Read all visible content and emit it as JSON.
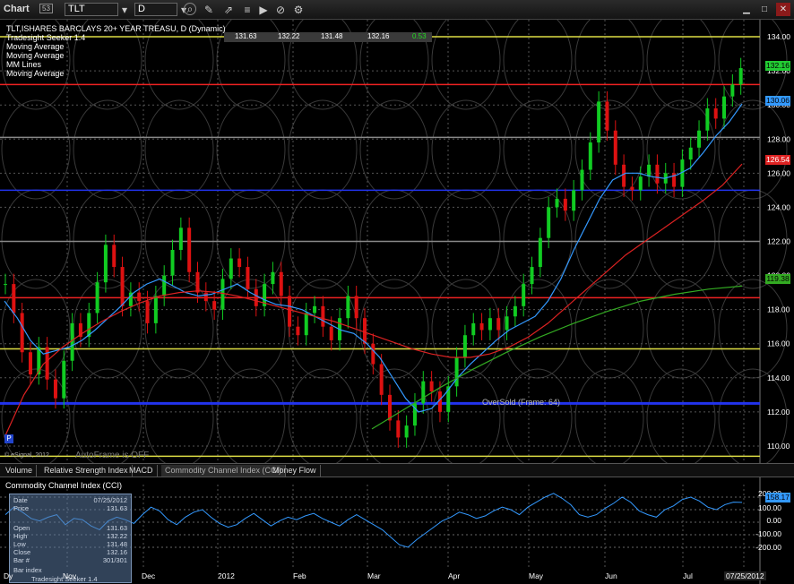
{
  "toolbar": {
    "app_label": "Chart",
    "symbol": "TLT",
    "interval": "D"
  },
  "header": {
    "title": "TLT,ISHARES BARCLAYS 20+ YEAR TREASU, D (Dynamic)",
    "legend": [
      "Tradesight Seeker 1.4",
      "Moving Average",
      "Moving Average",
      "MM Lines",
      "Moving Average"
    ],
    "ohlc": [
      "131.63",
      "132.22",
      "131.48",
      "132.16"
    ],
    "change": "0.53"
  },
  "colors": {
    "up": "#11cc22",
    "down": "#dd1111",
    "ma_fast": "#3399ff",
    "ma_mid": "#dd2222",
    "ma_slow": "#33aa22",
    "line_red": "#ee2222",
    "line_blue": "#2233ee",
    "line_yellow": "#dddd44"
  },
  "annotations": {
    "autoframe": "AutoFrame is OFF",
    "copyright": "© eSignal, 2012",
    "oversold": "OverSold (Frame: 64)",
    "p_marker": "P"
  },
  "price_tags": {
    "last": "132.16",
    "ma_fast": "130.06",
    "ma_mid": "126.54",
    "ma_slow": "119.38"
  },
  "tabs": [
    "Volume",
    "Relative Strength Index",
    "MACD",
    "Commodity Channel Index (CCI)",
    "Money Flow"
  ],
  "active_tab": 3,
  "cci_panel": {
    "title": "Commodity Channel Index (CCI)",
    "axis": [
      "200.00",
      "100.00",
      "0.00",
      "-100.00",
      "-200.00"
    ],
    "last_value": "158.17"
  },
  "data_window": {
    "rows": [
      "Date",
      "Price",
      "Open",
      "High",
      "Low",
      "Close",
      "Bar #",
      "Bar index"
    ],
    "values": [
      "07/25/2012",
      "131.63",
      "131.63",
      "132.22",
      "131.48",
      "132.16",
      "301/301",
      ""
    ],
    "footer": "Tradesight Seeker 1.4"
  },
  "x_axis": {
    "months": [
      "Nov",
      "Dec",
      "2012",
      "Feb",
      "Mar",
      "Apr",
      "May",
      "Jun",
      "Jul"
    ],
    "last_date": "07/25/2012"
  },
  "chart_data": {
    "type": "candlestick",
    "title": "TLT,ISHARES BARCLAYS 20+ YEAR TREASU, D (Dynamic)",
    "ylim": [
      109,
      135
    ],
    "y_ticks": [
      110,
      112,
      114,
      116,
      118,
      120,
      122,
      124,
      126,
      128,
      130,
      132,
      134
    ],
    "horizontal_levels": [
      {
        "value": 134.0,
        "color": "#dddd44"
      },
      {
        "value": 131.2,
        "color": "#ee2222"
      },
      {
        "value": 128.1,
        "color": "#888888"
      },
      {
        "value": 125.0,
        "color": "#2233ee"
      },
      {
        "value": 122.0,
        "color": "#888888"
      },
      {
        "value": 118.7,
        "color": "#ee2222"
      },
      {
        "value": 115.7,
        "color": "#dddd44"
      },
      {
        "value": 112.5,
        "color": "#2233ee"
      },
      {
        "value": 109.4,
        "color": "#dddd44"
      }
    ],
    "close_path": [
      119.5,
      117.8,
      115.5,
      114.2,
      115.8,
      113.9,
      112.8,
      115.0,
      117.2,
      116.4,
      117.8,
      119.6,
      121.8,
      120.5,
      118.2,
      119.0,
      118.5,
      117.2,
      118.8,
      120.0,
      121.5,
      122.8,
      120.2,
      119.0,
      118.5,
      118.0,
      119.8,
      121.0,
      120.5,
      119.2,
      118.2,
      119.5,
      120.2,
      118.8,
      117.0,
      116.5,
      117.8,
      118.2,
      117.0,
      116.2,
      117.5,
      118.8,
      117.5,
      116.0,
      114.8,
      113.0,
      111.5,
      110.5,
      111.2,
      112.5,
      113.8,
      113.2,
      112.0,
      113.5,
      115.2,
      116.5,
      117.2,
      116.8,
      117.5,
      116.8,
      117.6,
      118.2,
      119.5,
      120.5,
      122.2,
      124.0,
      124.5,
      123.8,
      125.0,
      126.2,
      127.8,
      130.2,
      128.5,
      126.5,
      125.2,
      125.0,
      125.8,
      126.5,
      125.4,
      126.0,
      125.2,
      126.8,
      127.5,
      128.5,
      129.8,
      129.2,
      130.5,
      131.2,
      132.16
    ],
    "ma_fast_path": [
      118.5,
      117.5,
      116.2,
      115.4,
      115.6,
      115.8,
      116.2,
      116.8,
      117.5,
      118.2,
      119.0,
      119.5,
      119.8,
      119.4,
      119.0,
      118.8,
      118.9,
      119.2,
      119.5,
      119.0,
      118.6,
      118.3,
      118.2,
      118.0,
      117.6,
      117.2,
      116.8,
      116.6,
      116.0,
      115.2,
      114.0,
      112.8,
      112.0,
      112.2,
      113.0,
      114.0,
      114.8,
      115.5,
      116.2,
      116.8,
      117.2,
      117.6,
      118.5,
      119.8,
      121.5,
      123.0,
      124.5,
      125.6,
      126.0,
      126.0,
      125.8,
      125.7,
      125.9,
      126.3,
      127.2,
      128.2,
      129.0,
      130.06
    ],
    "ma_mid_path": [
      110.5,
      113.0,
      114.8,
      115.8,
      116.6,
      117.3,
      117.9,
      118.4,
      118.8,
      119.0,
      119.1,
      119.0,
      118.8,
      118.5,
      118.2,
      117.9,
      117.6,
      117.3,
      116.9,
      116.5,
      116.1,
      115.7,
      115.4,
      115.2,
      115.2,
      115.4,
      115.8,
      116.4,
      117.2,
      118.2,
      119.2,
      120.2,
      121.2,
      122.0,
      122.8,
      123.6,
      124.4,
      125.3,
      126.54
    ],
    "ma_slow_path": [
      111.0,
      112.2,
      113.4,
      114.5,
      115.5,
      116.4,
      117.2,
      117.9,
      118.5,
      118.9,
      119.2,
      119.38
    ],
    "cci_path": [
      60,
      120,
      80,
      30,
      10,
      40,
      60,
      -20,
      30,
      20,
      -30,
      -60,
      10,
      40,
      20,
      -10,
      60,
      120,
      90,
      20,
      -20,
      40,
      80,
      100,
      40,
      -10,
      -40,
      -20,
      30,
      70,
      20,
      -30,
      10,
      40,
      20,
      50,
      70,
      30,
      0,
      -30,
      20,
      60,
      20,
      -20,
      -60,
      -120,
      -180,
      -200,
      -140,
      -90,
      -40,
      10,
      40,
      80,
      60,
      30,
      50,
      90,
      120,
      100,
      60,
      120,
      160,
      200,
      230,
      190,
      140,
      60,
      40,
      60,
      110,
      150,
      200,
      160,
      90,
      60,
      40,
      100,
      130,
      180,
      200,
      170,
      120,
      100,
      140,
      160,
      158
    ]
  }
}
